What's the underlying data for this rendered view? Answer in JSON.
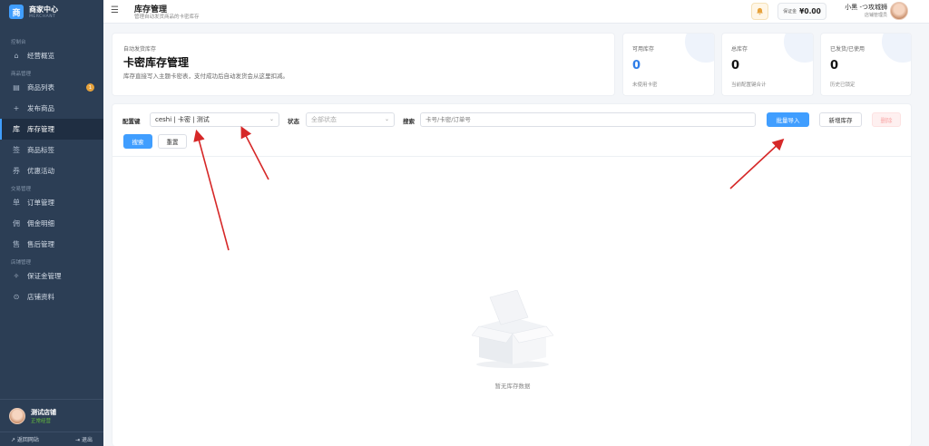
{
  "brand": {
    "logo_char": "商",
    "name": "商家中心",
    "sub": "MERCHANT"
  },
  "sidebar": {
    "groups": [
      {
        "label": "控制台",
        "items": [
          {
            "icon": "home-icon",
            "glyph": "⌂",
            "label": "经营概览"
          }
        ]
      },
      {
        "label": "商品管理",
        "items": [
          {
            "icon": "list-icon",
            "glyph": "▤",
            "label": "商品列表",
            "badge": "1"
          },
          {
            "icon": "plus-icon",
            "glyph": "+",
            "label": "发布商品"
          },
          {
            "icon": "warehouse-icon",
            "glyph": "库",
            "label": "库存管理",
            "active": true
          },
          {
            "icon": "tag-icon",
            "glyph": "签",
            "label": "商品标签"
          },
          {
            "icon": "coupon-icon",
            "glyph": "券",
            "label": "优惠活动"
          }
        ]
      },
      {
        "label": "交易管理",
        "items": [
          {
            "icon": "order-icon",
            "glyph": "单",
            "label": "订单管理"
          },
          {
            "icon": "commission-icon",
            "glyph": "佣",
            "label": "佣金明细"
          },
          {
            "icon": "aftersale-icon",
            "glyph": "售",
            "label": "售后管理"
          }
        ]
      },
      {
        "label": "店铺管理",
        "items": [
          {
            "icon": "deposit-icon",
            "glyph": "✧",
            "label": "保证金管理"
          },
          {
            "icon": "store-info-icon",
            "glyph": "⊙",
            "label": "店铺资料"
          }
        ]
      }
    ],
    "user": {
      "name": "测试店铺",
      "status": "正常经营"
    },
    "footer": {
      "back": "↗ 返回网站",
      "logout": "⇥ 退出"
    }
  },
  "header": {
    "menu_glyph": "☰",
    "title": "库存管理",
    "subtitle": "管理自动发货商品的卡密库存",
    "bell_glyph": "🔔",
    "deposit_label": "保证金",
    "deposit_value": "¥0.00",
    "user_name": "小黑 ‑つ攻城狮",
    "user_role": "店铺管理员"
  },
  "hero": {
    "kicker": "自动发货库存",
    "title": "卡密库存管理",
    "desc": "库存直接写入主题卡密表，支付成功后自动发货会从这里扣减。"
  },
  "stats": [
    {
      "label": "可用库存",
      "value": "0",
      "sub": "未使用卡密",
      "accent": "#2f7ee8"
    },
    {
      "label": "总库存",
      "value": "0",
      "sub": "当前配置键合计"
    },
    {
      "label": "已发货/已使用",
      "value": "0",
      "sub": "历史已锁定"
    }
  ],
  "filters": {
    "config_label": "配置键",
    "config_value": "ceshi | 卡密 | 测试",
    "status_label": "状态",
    "status_value": "全部状态",
    "search_label": "搜索",
    "search_placeholder": "卡号/卡密/订单号"
  },
  "actions": {
    "batch_import": "批量导入",
    "add_stock": "新增库存",
    "delete": "删除",
    "search": "搜索",
    "reset": "重置"
  },
  "empty": {
    "text": "暂无库存数据"
  },
  "colors": {
    "primary": "#409eff",
    "sidebar": "#2c3e55",
    "annotation": "#d62828"
  }
}
